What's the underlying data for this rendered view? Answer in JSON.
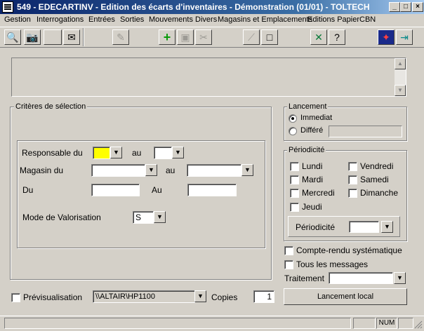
{
  "window": {
    "title": "549 - EDECARTINV - Edition des écarts d'inventaires - Démonstration (01/01) - TOLTECH"
  },
  "menu": [
    "Gestion",
    "Interrogations",
    "Entrées",
    "Sorties",
    "Mouvements Divers",
    "Magasins et Emplacements",
    "Editions Papier",
    "CBN"
  ],
  "toolbar": {
    "buttons": [
      "zoom-icon",
      "camera-icon",
      "",
      "envelope-icon",
      "edit-icon",
      "add-icon",
      "save-icon",
      "cut-icon",
      "eraser-icon",
      "new-page-icon",
      "excel-icon",
      "help-icon",
      "app-logo-icon",
      "exit-icon"
    ]
  },
  "criteria": {
    "title": "Critères de sélection",
    "responsable_label": "Responsable du",
    "au_label": "au",
    "magasin_label": "Magasin du",
    "magasin_au_label": "au",
    "du_label": "Du",
    "Au_label": "Au",
    "mode_label": "Mode de Valorisation",
    "mode_value": "S"
  },
  "lancement": {
    "title": "Lancement",
    "immediat": "Immediat",
    "differe": "Différé"
  },
  "periodicite": {
    "title": "Périodicité",
    "days": [
      "Lundi",
      "Mardi",
      "Mercredi",
      "Jeudi",
      "Vendredi",
      "Samedi",
      "Dimanche"
    ],
    "periodicite_label": "Périodicité"
  },
  "options": {
    "compte_rendu": "Compte-rendu systématique",
    "tous_messages": "Tous les messages",
    "traitement": "Traitement",
    "lancement_local": "Lancement local"
  },
  "bottom": {
    "previsualisation": "Prévisualisation",
    "printer": "\\\\ALTAIR\\HP1100",
    "copies_label": "Copies",
    "copies_value": "1"
  },
  "status": {
    "num": "NUM"
  },
  "colors": {
    "highlight_field": "#ffff00",
    "titlebar": "#0a246a"
  }
}
